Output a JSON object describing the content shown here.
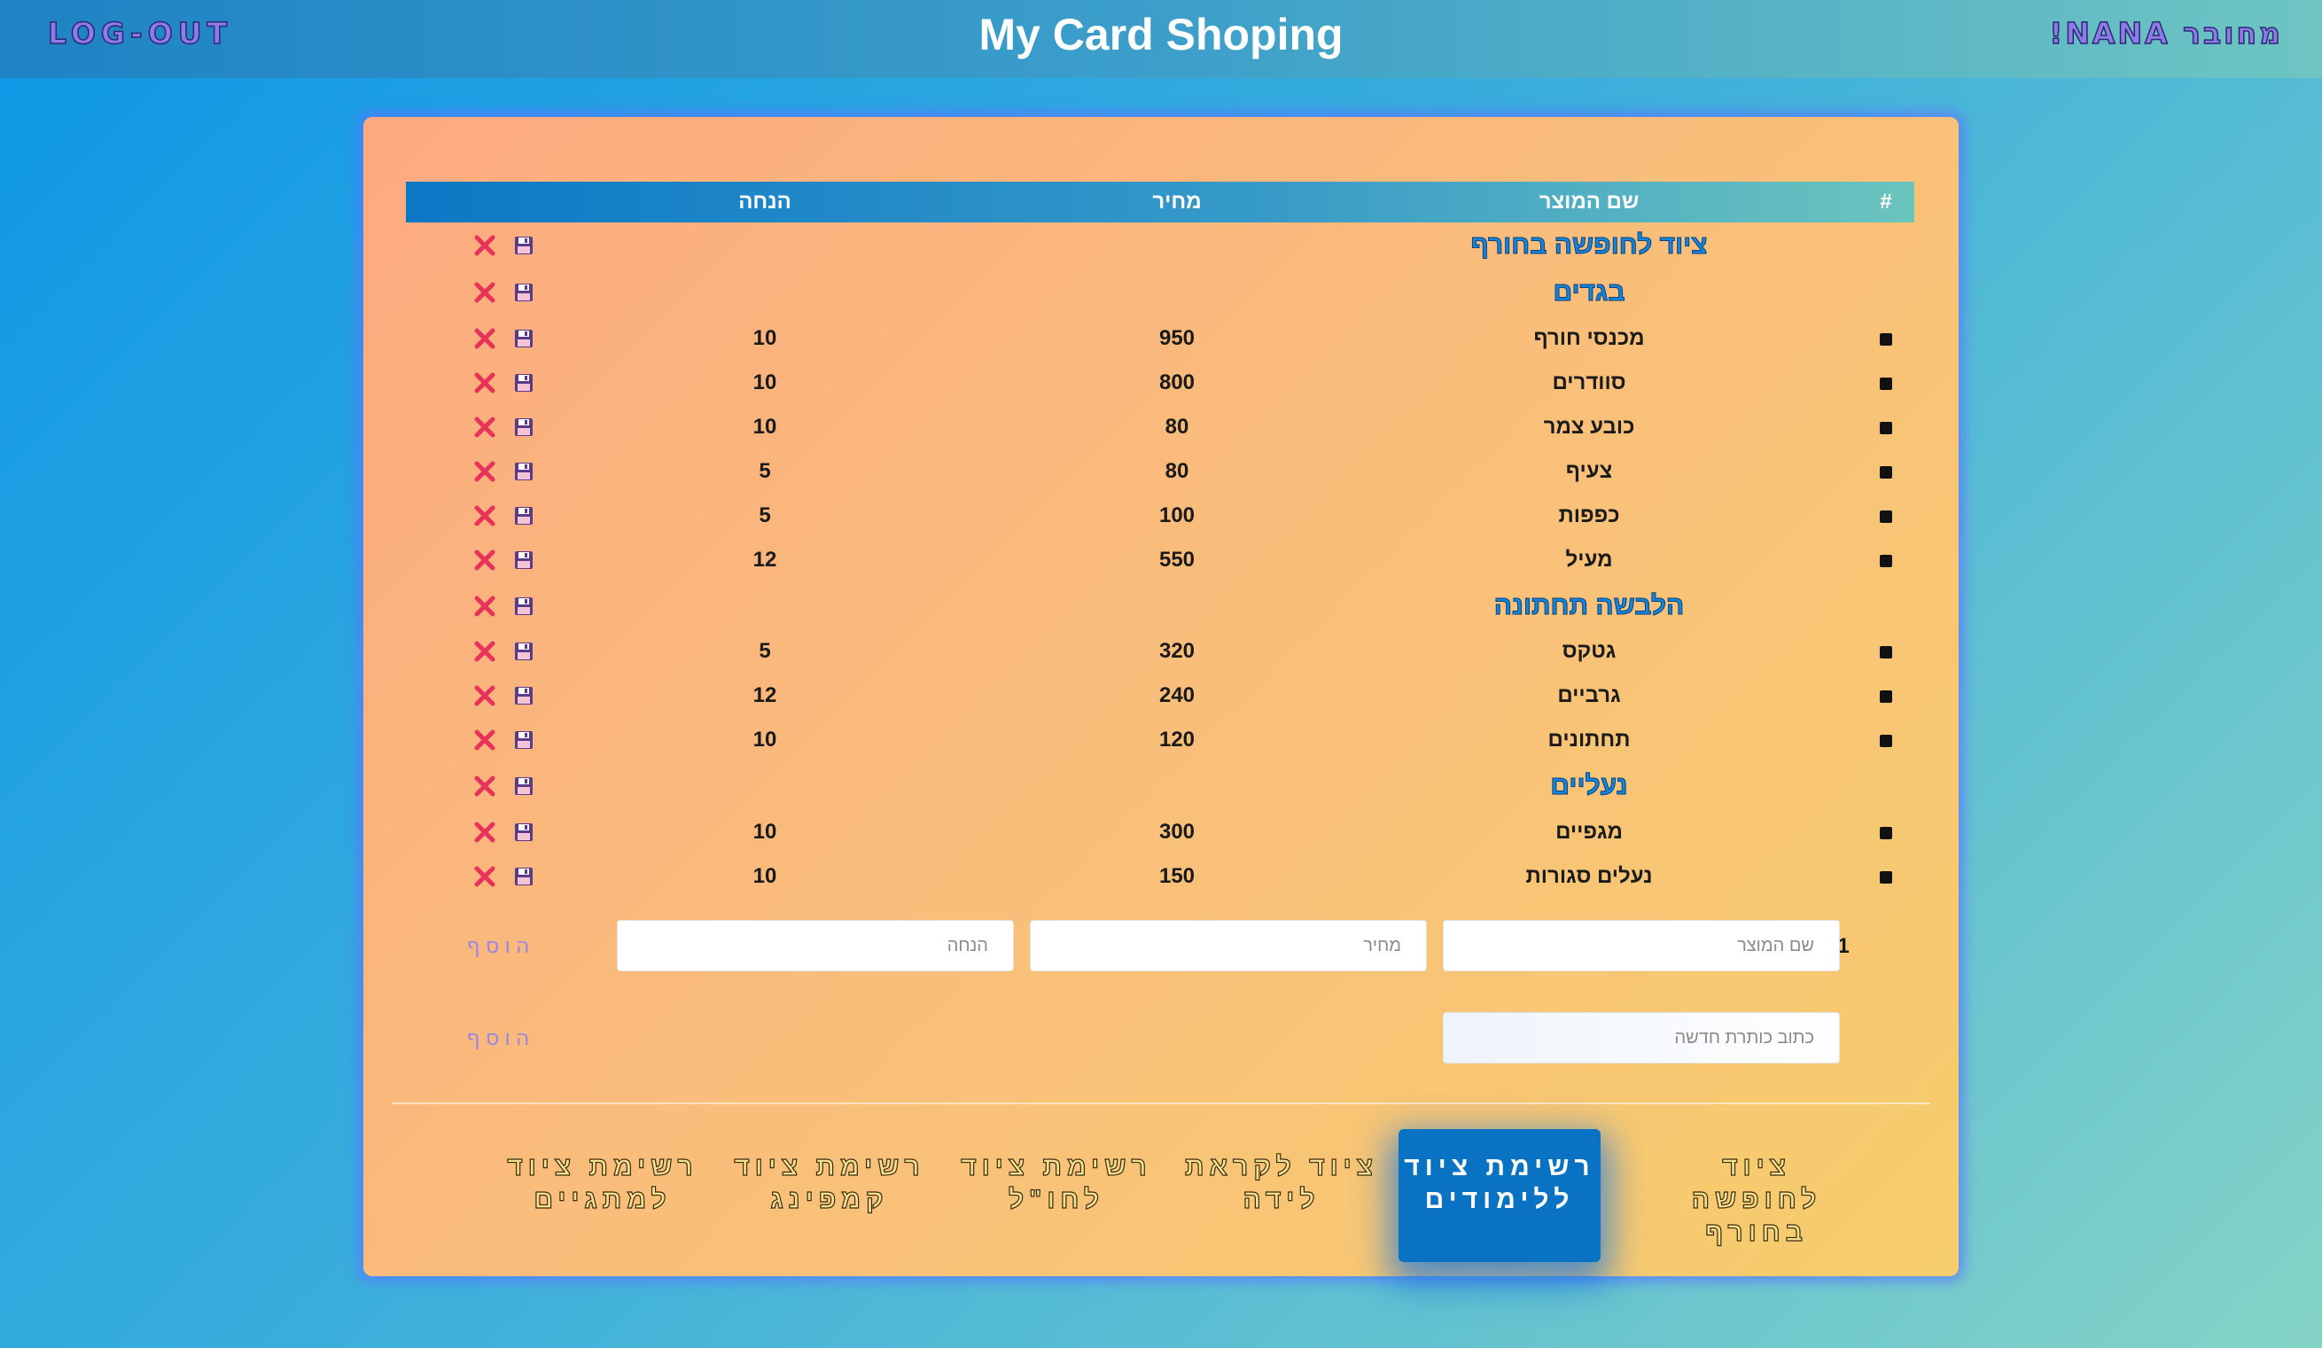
{
  "header": {
    "logout_label": "LOG-OUT",
    "title": "My Card Shoping",
    "greeting": "!NANA מחובר"
  },
  "table": {
    "columns": {
      "index": "#",
      "product": "שם המוצר",
      "price": "מחיר",
      "discount": "הנחה"
    },
    "list_title": "ציוד לחופשה בחורף",
    "categories": [
      {
        "title": "בגדים",
        "items": [
          {
            "name": "מכנסי חורף",
            "price": "950",
            "discount": "10"
          },
          {
            "name": "סוודרים",
            "price": "800",
            "discount": "10"
          },
          {
            "name": "כובע צמר",
            "price": "80",
            "discount": "10"
          },
          {
            "name": "צעיף",
            "price": "80",
            "discount": "5"
          },
          {
            "name": "כפפות",
            "price": "100",
            "discount": "5"
          },
          {
            "name": "מעיל",
            "price": "550",
            "discount": "12"
          }
        ]
      },
      {
        "title": "הלבשה תחתונה",
        "items": [
          {
            "name": "גטקס",
            "price": "320",
            "discount": "5"
          },
          {
            "name": "גרביים",
            "price": "240",
            "discount": "12"
          },
          {
            "name": "תחתונים",
            "price": "120",
            "discount": "10"
          }
        ]
      },
      {
        "title": "נעליים",
        "items": [
          {
            "name": "מגפיים",
            "price": "300",
            "discount": "10"
          },
          {
            "name": "נעלים סגורות",
            "price": "150",
            "discount": "10"
          }
        ]
      }
    ]
  },
  "add_item_form": {
    "row_number": "1",
    "product_placeholder": "שם המוצר",
    "price_placeholder": "מחיר",
    "discount_placeholder": "הנחה",
    "add_label": "הוסף"
  },
  "add_title_form": {
    "title_placeholder": "כתוב כותרת חדשה",
    "add_label": "הוסף"
  },
  "tabs": [
    {
      "label": "ציוד לחופשה בחורף",
      "active": false
    },
    {
      "label": "רשימת ציוד ללימודים",
      "active": true
    },
    {
      "label": "ציוד לקראת לידה",
      "active": false
    },
    {
      "label": "רשימת ציוד לחו\"ל",
      "active": false
    },
    {
      "label": "רשימת ציוד קמפינג",
      "active": false
    },
    {
      "label": "רשימת ציוד למתגיים",
      "active": false
    }
  ],
  "colors": {
    "delete_icon": "#e8325a",
    "save_icon": "#5b3a8c",
    "category_title": "#1586d8",
    "active_tab": "#0a72c2"
  },
  "icons": {
    "delete": "close-icon",
    "save": "floppy-disk-icon",
    "bullet": "square-bullet-icon"
  }
}
